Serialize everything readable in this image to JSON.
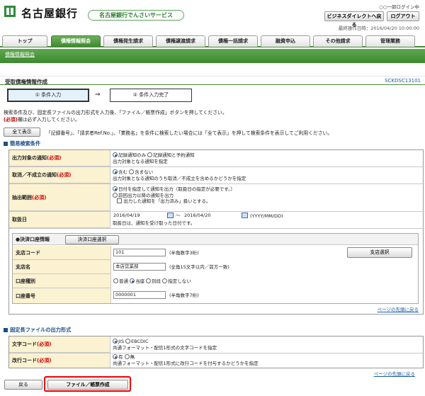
{
  "header": {
    "bank_name": "名古屋銀行",
    "service_badge": "名古屋銀行でんさいサービス",
    "user_login": "○○一郎ログイン中",
    "btn_digital": "ビジネスダイレクトへ戻る",
    "btn_logout": "ログアウト",
    "last_operation": "最終操作日時：2016/04/20 10:00:00"
  },
  "tabs": [
    "トップ",
    "債権情報照会",
    "債権発生請求",
    "債権譲渡請求",
    "債権一括請求",
    "融資申込",
    "その他請求",
    "管理業務"
  ],
  "active_tab": "債権情報照会",
  "subnav": {
    "link": "債権情報照会"
  },
  "page": {
    "title": "受取債権情報作成",
    "screen_id": "SCKDSC13101"
  },
  "steps": {
    "step1": "① 条件入力",
    "arrow": "⇒",
    "step2": "② 条件入力完了"
  },
  "instructions": {
    "line1": "検索条件及び、固定長ファイルの出力形式を入力後、「ファイル／帳票作成」ボタンを押してください。",
    "line2_req": "(必須)",
    "line2": "欄は必ず入力してください。"
  },
  "show_all": {
    "button": "全て表示",
    "text": "「記録番号」、「請求者Ref.No.」、「業務名」を条件に検索したい場合には「全て表示」を押して検索条件を表示してご利用ください。"
  },
  "simple_search": {
    "heading": "簡易検索条件",
    "notify_label": "出力対象の通知",
    "notify_opt1": "記録通知のみ",
    "notify_opt2": "記録通知と予約通知",
    "notify_desc": "出力対象となる通知を指定",
    "cancel_label": "取消／不成立の通知",
    "cancel_opt1": "含む",
    "cancel_opt2": "含まない",
    "cancel_desc": "出力対象となる通知のうち取消／不成立を含めるかどうかを指定",
    "range_label": "抽出範囲",
    "range_opt1": "日付を指定して通知を出力（取扱日の指定が必要です。）",
    "range_opt2": "前回出力以降の通知を出力",
    "range_chk": "出力した通知を「出力済み」扱いとする。",
    "date_label": "取扱日",
    "date_from": "2016/04/19",
    "date_sep": "～",
    "date_to": "2016/04/20",
    "date_fmt": "(YYYY/MM/DD)",
    "date_desc": "取扱日は、通知を受け取った日付です。",
    "required": "(必須)"
  },
  "account": {
    "header": "●決済口座情報",
    "select_btn": "決済口座選択",
    "branch_code_label": "支店コード",
    "branch_code": "101",
    "branch_code_hint": "(半角数字3桁)",
    "branch_select_btn": "支店選択",
    "branch_name_label": "支店名",
    "branch_name": "本店営業部",
    "branch_name_hint": "(全角15文字以内／前方一致)",
    "type_label": "口座種別",
    "type_opt1": "普通",
    "type_opt2": "当座",
    "type_opt3": "別段",
    "type_opt4": "指定しない",
    "number_label": "口座番号",
    "number": "0000001",
    "number_hint": "(半角数字7桁)"
  },
  "page_top_link": "ページの先頭に戻る",
  "fixed_output": {
    "heading": "固定長ファイルの出力形式",
    "charcode_label": "文字コード",
    "charcode_opt1": "JIS",
    "charcode_opt2": "EBCDIC",
    "charcode_desc": "共通フォーマット・配信1形式の文字コードを指定",
    "newline_label": "改行コード",
    "newline_opt1": "有",
    "newline_opt2": "無",
    "newline_desc": "共通フォーマット・配信1形式に改行コードを付与するかどうかを指定"
  },
  "footer": {
    "back_btn": "戻る",
    "create_btn": "ファイル／帳票作成"
  },
  "colors": {
    "brand_green": "#3f8a30",
    "label_bg": "#fbf2d1",
    "required": "#cc0000",
    "highlight": "#ee0000"
  }
}
